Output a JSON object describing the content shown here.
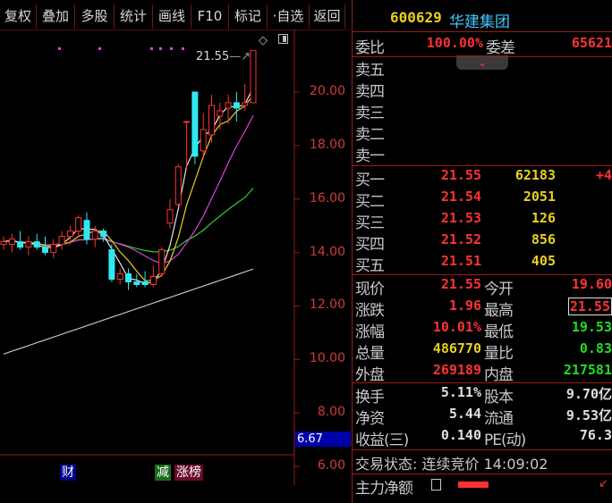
{
  "toolbar": {
    "buttons": [
      "复权",
      "叠加",
      "多股",
      "统计",
      "画线",
      "F10",
      "标记",
      "·自选",
      "返回"
    ]
  },
  "chart": {
    "price_labels": [
      "20.00",
      "18.00",
      "16.00",
      "14.00",
      "12.00",
      "10.00",
      "8.00",
      "6.00"
    ],
    "last_value_label": "6.67",
    "peak_annotation": "21.55",
    "event_tags": [
      "财",
      "减",
      "涨榜"
    ]
  },
  "chart_data": {
    "type": "candlestick",
    "y_axis_ticks": [
      20.0,
      18.0,
      16.0,
      14.0,
      12.0,
      10.0,
      8.0,
      6.0
    ],
    "peak_price": 21.55,
    "candles": [
      {
        "o": 14.3,
        "h": 14.6,
        "l": 14.1,
        "c": 14.4
      },
      {
        "o": 14.3,
        "h": 14.7,
        "l": 14.0,
        "c": 14.5
      },
      {
        "o": 14.4,
        "h": 14.8,
        "l": 14.1,
        "c": 14.2
      },
      {
        "o": 14.2,
        "h": 14.6,
        "l": 13.9,
        "c": 14.4
      },
      {
        "o": 14.4,
        "h": 14.7,
        "l": 14.1,
        "c": 14.2
      },
      {
        "o": 14.2,
        "h": 14.6,
        "l": 13.9,
        "c": 14.0
      },
      {
        "o": 14.0,
        "h": 14.5,
        "l": 13.8,
        "c": 14.3
      },
      {
        "o": 14.3,
        "h": 14.8,
        "l": 14.1,
        "c": 14.6
      },
      {
        "o": 14.6,
        "h": 15.0,
        "l": 14.3,
        "c": 14.8
      },
      {
        "o": 14.8,
        "h": 15.4,
        "l": 14.6,
        "c": 15.3
      },
      {
        "o": 15.2,
        "h": 15.5,
        "l": 14.3,
        "c": 14.5
      },
      {
        "o": 14.5,
        "h": 15.0,
        "l": 14.2,
        "c": 14.8
      },
      {
        "o": 14.8,
        "h": 14.9,
        "l": 14.4,
        "c": 14.6
      },
      {
        "o": 14.1,
        "h": 14.3,
        "l": 12.9,
        "c": 13.0
      },
      {
        "o": 13.0,
        "h": 13.4,
        "l": 12.8,
        "c": 13.2
      },
      {
        "o": 13.2,
        "h": 13.4,
        "l": 12.6,
        "c": 12.9
      },
      {
        "o": 12.9,
        "h": 13.2,
        "l": 12.7,
        "c": 12.8
      },
      {
        "o": 12.9,
        "h": 13.3,
        "l": 12.7,
        "c": 12.8
      },
      {
        "o": 12.8,
        "h": 13.5,
        "l": 12.7,
        "c": 13.1
      },
      {
        "o": 13.2,
        "h": 14.2,
        "l": 13.1,
        "c": 14.1
      },
      {
        "o": 15.1,
        "h": 16.0,
        "l": 14.9,
        "c": 15.6
      },
      {
        "o": 15.8,
        "h": 17.3,
        "l": 15.7,
        "c": 17.2
      },
      {
        "o": 18.9,
        "h": 18.9,
        "l": 17.1,
        "c": 18.9
      },
      {
        "o": 20.0,
        "h": 20.0,
        "l": 17.3,
        "c": 17.6
      },
      {
        "o": 17.8,
        "h": 19.2,
        "l": 17.5,
        "c": 18.6
      },
      {
        "o": 18.4,
        "h": 19.9,
        "l": 18.1,
        "c": 19.5
      },
      {
        "o": 19.1,
        "h": 19.6,
        "l": 18.6,
        "c": 19.3
      },
      {
        "o": 19.4,
        "h": 19.9,
        "l": 18.8,
        "c": 19.6
      },
      {
        "o": 19.6,
        "h": 20.0,
        "l": 18.9,
        "c": 19.4
      },
      {
        "o": 19.5,
        "h": 20.3,
        "l": 19.3,
        "c": 19.6
      },
      {
        "o": 19.6,
        "h": 21.55,
        "l": 19.6,
        "c": 21.55
      }
    ]
  },
  "quote": {
    "code": "600629",
    "name": "华建集团",
    "weibi_label": "委比",
    "weibi_value": "100.00%",
    "weicha_label": "委差",
    "weicha_value": "65621",
    "sell_labels": [
      "卖五",
      "卖四",
      "卖三",
      "卖二",
      "卖一"
    ],
    "buy": [
      {
        "label": "买一",
        "price": "21.55",
        "vol": "62183",
        "extra": "+4"
      },
      {
        "label": "买二",
        "price": "21.54",
        "vol": "2051",
        "extra": ""
      },
      {
        "label": "买三",
        "price": "21.53",
        "vol": "126",
        "extra": ""
      },
      {
        "label": "买四",
        "price": "21.52",
        "vol": "856",
        "extra": ""
      },
      {
        "label": "买五",
        "price": "21.51",
        "vol": "405",
        "extra": ""
      }
    ],
    "stats1": [
      {
        "l1": "现价",
        "v1": "21.55",
        "l2": "今开",
        "v2": "19.60"
      },
      {
        "l1": "涨跌",
        "v1": "1.96",
        "l2": "最高",
        "v2": "21.55"
      },
      {
        "l1": "涨幅",
        "v1": "10.01%",
        "l2": "最低",
        "v2": "19.53"
      },
      {
        "l1": "总量",
        "v1": "486770",
        "l2": "量比",
        "v2": "0.83"
      },
      {
        "l1": "外盘",
        "v1": "269189",
        "l2": "内盘",
        "v2": "217581"
      }
    ],
    "stats2": [
      {
        "l1": "换手",
        "v1": "5.11%",
        "l2": "股本",
        "v2": "9.70亿"
      },
      {
        "l1": "净资",
        "v1": "5.44",
        "l2": "流通",
        "v2": "9.53亿"
      },
      {
        "l1": "收益(三)",
        "v1": "0.140",
        "l2": "PE(动)",
        "v2": "76.3"
      }
    ],
    "trade_status": "交易状态: 连续竞价 14:09:02",
    "main_net_label": "主力净额"
  },
  "colors": {
    "up": "#ff3232",
    "down": "#30e8f0",
    "ma_white": "#e8e8e8",
    "ma_yellow": "#e8d020",
    "ma_magenta": "#e040e0",
    "ma_green": "#30d030",
    "ma_gray": "#c0c0c0"
  }
}
